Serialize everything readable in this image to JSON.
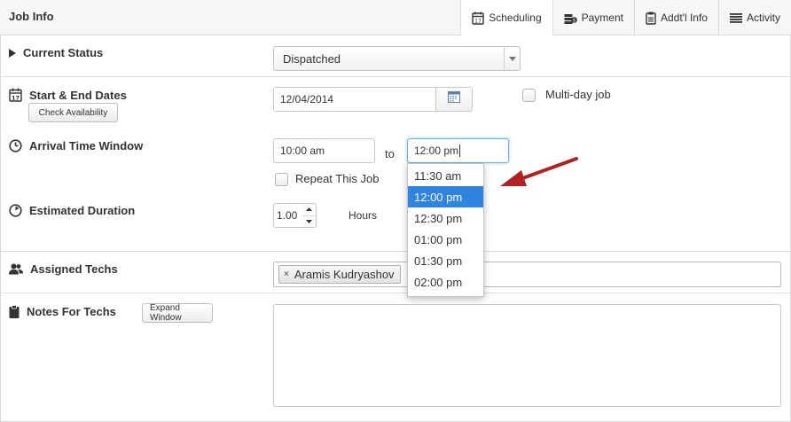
{
  "header": {
    "title": "Job Info",
    "tabs": [
      {
        "label": "Scheduling",
        "icon": "calendar-icon",
        "active": true
      },
      {
        "label": "Payment",
        "icon": "money-icon",
        "active": false
      },
      {
        "label": "Addt'l Info",
        "icon": "clipboard-icon",
        "active": false
      },
      {
        "label": "Activity",
        "icon": "list-icon",
        "active": false
      }
    ]
  },
  "status": {
    "label": "Current Status",
    "value": "Dispatched"
  },
  "dates": {
    "label": "Start & End Dates",
    "check_button": "Check Availability",
    "date_value": "12/04/2014",
    "multiday_label": "Multi-day job"
  },
  "arrival": {
    "label": "Arrival Time Window",
    "start": "10:00 am",
    "to": "to",
    "end": "12:00 pm",
    "repeat_label": "Repeat This Job"
  },
  "time_options": [
    "11:30 am",
    "12:00 pm",
    "12:30 pm",
    "01:00 pm",
    "01:30 pm",
    "02:00 pm"
  ],
  "time_selected": "12:00 pm",
  "duration": {
    "label": "Estimated Duration",
    "value": "1.00",
    "unit": "Hours"
  },
  "techs": {
    "label": "Assigned Techs",
    "tag": "Aramis Kudryashov",
    "remove": "×"
  },
  "notes": {
    "label": "Notes For Techs",
    "expand_button": "Expand Window"
  },
  "colors": {
    "accent": "#2f84e0",
    "annotation_arrow": "#b22222",
    "focus_border": "#66afe9"
  }
}
